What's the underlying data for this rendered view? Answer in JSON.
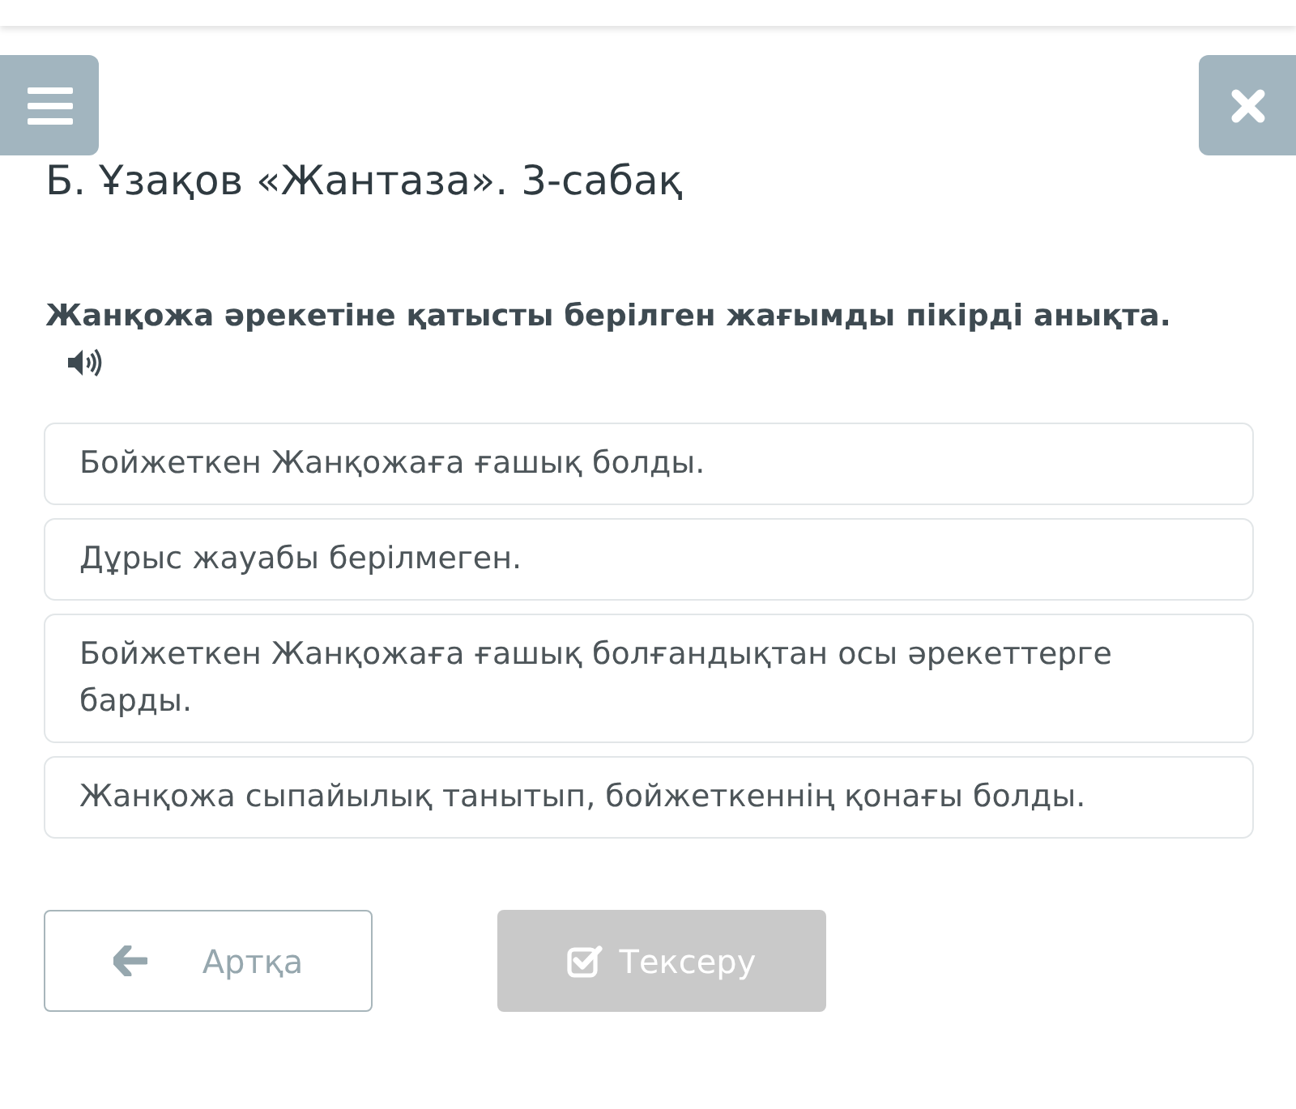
{
  "title": "Б. Ұзақов «Жантаза». 3-сабақ",
  "question": {
    "text": "Жанқожа әрекетіне қатысты берілген жағымды пікірді анықта."
  },
  "options": [
    {
      "text": "Бойжеткен Жанқожаға ғашық болды.",
      "selected": false
    },
    {
      "text": "Дұрыс жауабы берілмеген.",
      "selected": false
    },
    {
      "text": "Бойжеткен Жанқожаға ғашық болғандықтан осы әрекеттерге барды.",
      "selected": false
    },
    {
      "text": "Жанқожа сыпайылық танытып, бойжеткеннің қонағы болды.",
      "selected": false
    }
  ],
  "buttons": [
    {
      "kind": "back",
      "label": "Артқа",
      "disabled": false
    },
    {
      "kind": "check",
      "label": "Тексеру",
      "disabled": true
    }
  ]
}
